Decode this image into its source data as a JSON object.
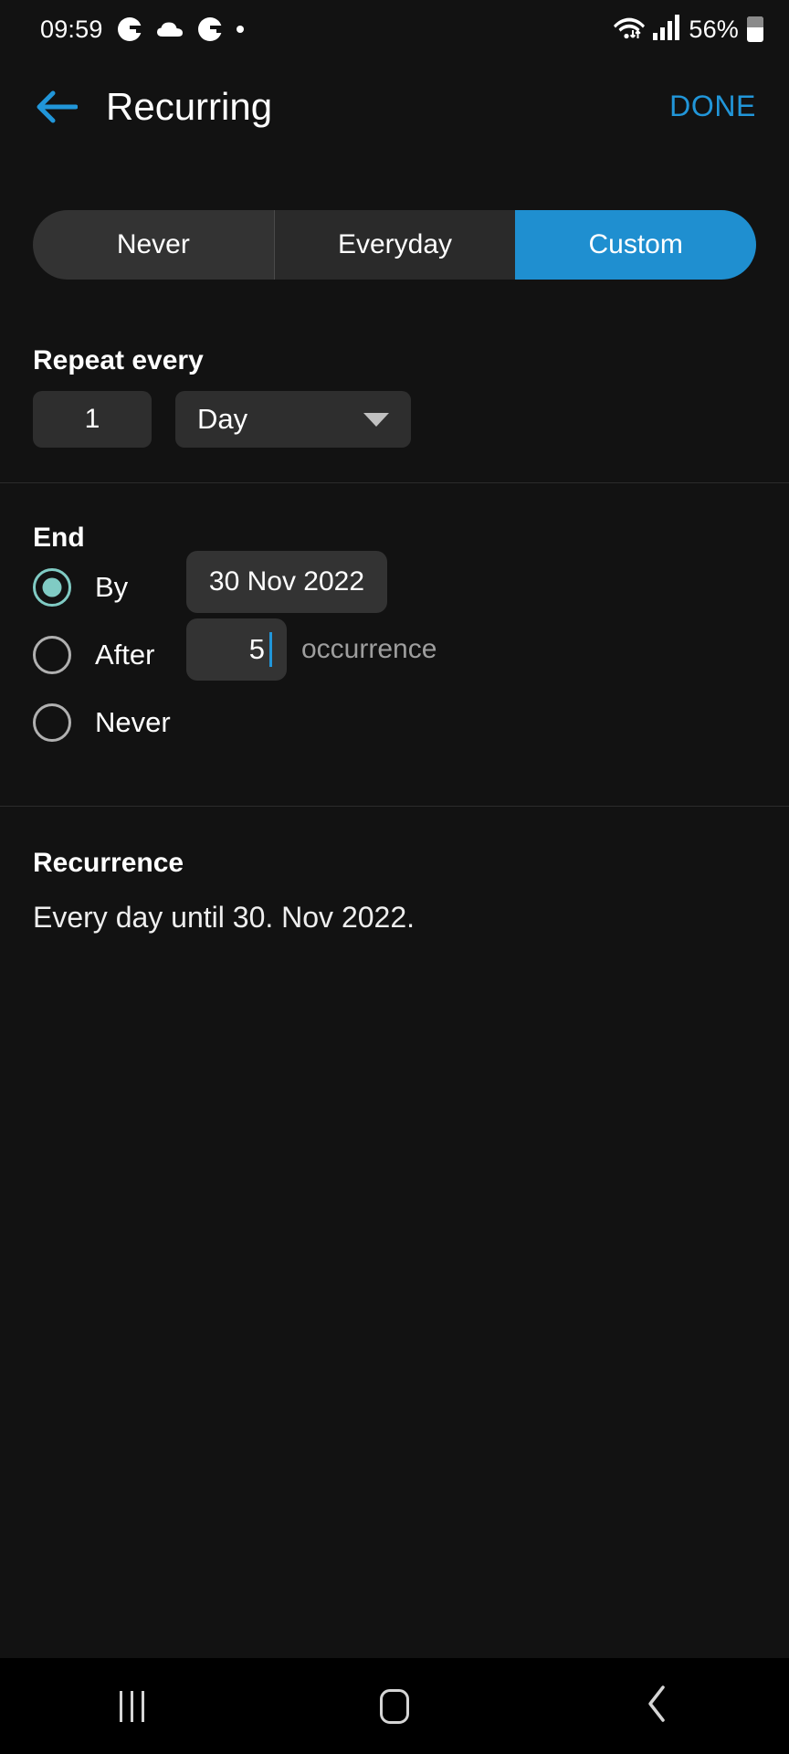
{
  "status_bar": {
    "clock": "09:59",
    "notification_icons": [
      "app-g-icon",
      "cloud-icon",
      "app-g-icon",
      "dot-icon"
    ],
    "wifi_icon": "wifi-icon",
    "signal_icon": "signal-icon",
    "battery_percent": "56%",
    "battery_icon": "battery-icon"
  },
  "app_bar": {
    "back_icon": "back-arrow-icon",
    "title": "Recurring",
    "done_label": "DONE",
    "accent_color": "#2196d9"
  },
  "segmented_control": {
    "options": [
      {
        "label": "Never",
        "selected": false
      },
      {
        "label": "Everyday",
        "selected": false
      },
      {
        "label": "Custom",
        "selected": true
      }
    ],
    "selected_color": "#1f8fd0"
  },
  "repeat": {
    "heading": "Repeat every",
    "interval_value": "1",
    "unit_value": "Day",
    "unit_caret_icon": "chevron-down-icon"
  },
  "end": {
    "heading": "End",
    "options": [
      {
        "label": "By",
        "selected": true
      },
      {
        "label": "After",
        "selected": false
      },
      {
        "label": "Never",
        "selected": false
      }
    ],
    "date_value": "30 Nov 2022",
    "occurrence_value": "5",
    "occurrence_label": "occurrence",
    "radio_selected_color": "#80cbc4",
    "cursor_color": "#2196d9"
  },
  "recurrence": {
    "heading": "Recurrence",
    "summary": "Every day until 30. Nov 2022."
  },
  "nav_bar": {
    "recents_icon": "recents-icon",
    "home_icon": "home-icon",
    "back_icon": "back-icon"
  }
}
